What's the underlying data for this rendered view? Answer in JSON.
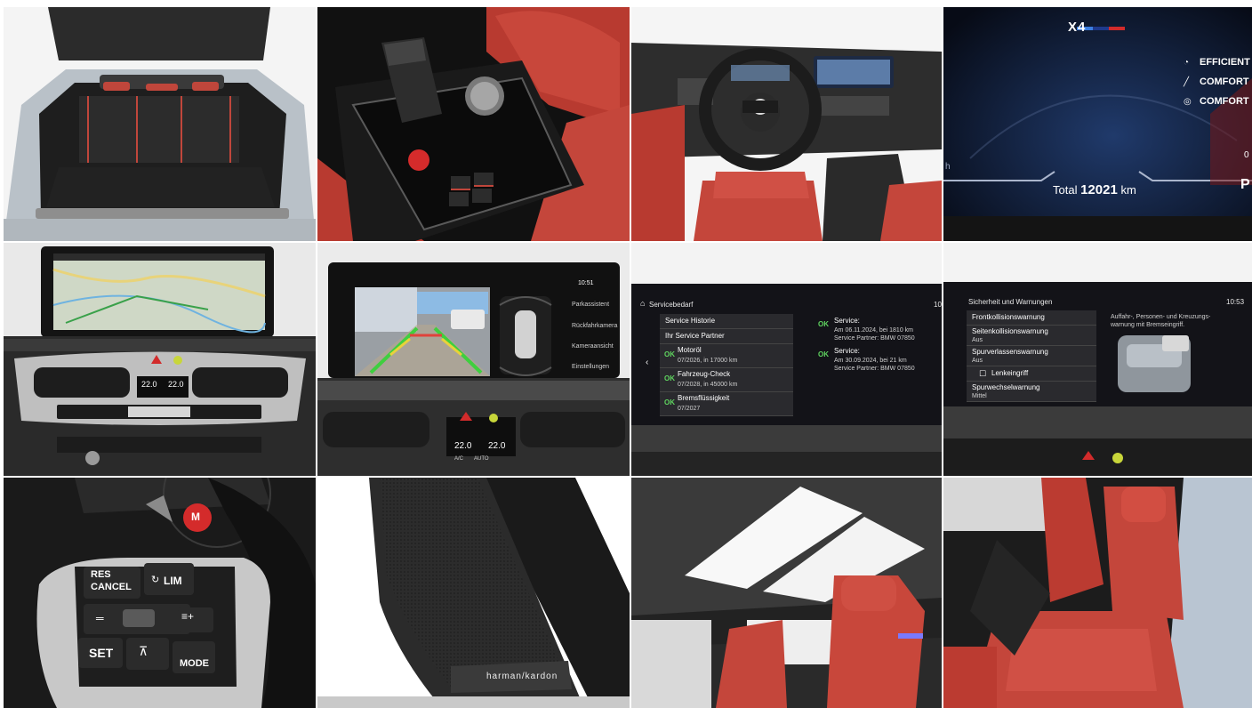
{
  "cluster": {
    "badge": "X4",
    "modes": [
      "EFFICIENT",
      "COMFORT",
      "COMFORT"
    ],
    "total_label": "Total",
    "total_value": "12021",
    "total_unit": "km",
    "edge_left": "h",
    "edge_right": "0",
    "gear": "P"
  },
  "climate": {
    "temp_left": "22.0",
    "temp_right": "22.0",
    "ac": "A/C",
    "auto": "AUTO"
  },
  "camera_screen": {
    "time": "10:51",
    "menu": [
      "Parkassistent",
      "Rückfahrkamera",
      "Kameraansicht",
      "Einstellungen"
    ]
  },
  "service": {
    "title": "Servicebedarf",
    "time": "10",
    "menu_history": "Service Historie",
    "menu_partner": "Ihr Service Partner",
    "items": [
      {
        "status": "OK",
        "name": "Motoröl",
        "detail": "07/2026, in 17000 km"
      },
      {
        "status": "OK",
        "name": "Fahrzeug-Check",
        "detail": "07/2028, in 45000 km"
      },
      {
        "status": "OK",
        "name": "Bremsflüssigkeit",
        "detail": "07/2027"
      }
    ],
    "history": [
      {
        "status": "OK",
        "label": "Service:",
        "line1": "Am 06.11.2024, bei 1810 km",
        "line2": "Service Partner: BMW 07850"
      },
      {
        "status": "OK",
        "label": "Service:",
        "line1": "Am 30.09.2024, bei 21 km",
        "line2": "Service Partner: BMW 07850"
      }
    ]
  },
  "safety": {
    "title": "Sicherheit und Warnungen",
    "time": "10:53",
    "rows": [
      {
        "name": "Frontkollisionswarnung",
        "value": ""
      },
      {
        "name": "Seitenkollisionswarnung",
        "value": "Aus"
      },
      {
        "name": "Spurverlassenswarnung",
        "value": "Aus"
      },
      {
        "name": "Lenkeingriff",
        "value": ""
      },
      {
        "name": "Spurwechselwarnung",
        "value": "Mittel"
      }
    ],
    "description": "Auffahr-, Personen- und Kreuzungs-",
    "description2": "warnung mit Bremseingriff."
  },
  "wheel": {
    "res_cancel_1": "RES",
    "res_cancel_2": "CANCEL",
    "lim": "LIM",
    "set": "SET",
    "mode": "MODE",
    "m_button": "M"
  },
  "speaker": {
    "brand": "harman/kardon"
  },
  "colors": {
    "leather_red": "#c4463b",
    "screen_dark": "#141418",
    "ok_green": "#5fd35f",
    "bmw_red": "#b3262b"
  }
}
